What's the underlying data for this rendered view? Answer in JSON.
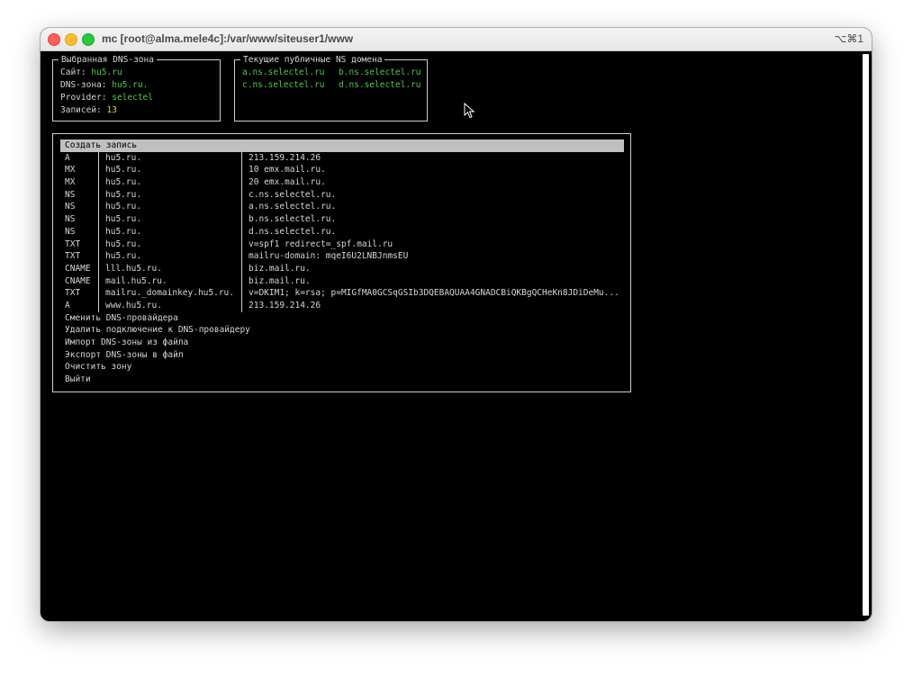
{
  "window": {
    "title": "mc [root@alma.mele4c]:/var/www/siteuser1/www",
    "shortcut": "⌥⌘1"
  },
  "zone_panel": {
    "legend": "Выбранная DNS-зона",
    "site_label": "Сайт:",
    "site_value": "hu5.ru",
    "zone_label": "DNS-зона:",
    "zone_value": "hu5.ru.",
    "provider_label": "Provider:",
    "provider_value": "selectel",
    "records_label": "Записей:",
    "records_value": "13"
  },
  "ns_panel": {
    "legend": "Текущие публичные NS домена",
    "ns": [
      "a.ns.selectel.ru",
      "b.ns.selectel.ru",
      "c.ns.selectel.ru",
      "d.ns.selectel.ru"
    ]
  },
  "menu": {
    "create": "Создать запись",
    "records": [
      {
        "type": "A",
        "name": "hu5.ru.",
        "value": "213.159.214.26"
      },
      {
        "type": "MX",
        "name": "hu5.ru.",
        "value": "10 emx.mail.ru."
      },
      {
        "type": "MX",
        "name": "hu5.ru.",
        "value": "20 emx.mail.ru."
      },
      {
        "type": "NS",
        "name": "hu5.ru.",
        "value": "c.ns.selectel.ru."
      },
      {
        "type": "NS",
        "name": "hu5.ru.",
        "value": "a.ns.selectel.ru."
      },
      {
        "type": "NS",
        "name": "hu5.ru.",
        "value": "b.ns.selectel.ru."
      },
      {
        "type": "NS",
        "name": "hu5.ru.",
        "value": "d.ns.selectel.ru."
      },
      {
        "type": "TXT",
        "name": "hu5.ru.",
        "value": "v=spf1 redirect=_spf.mail.ru"
      },
      {
        "type": "TXT",
        "name": "hu5.ru.",
        "value": "mailru-domain: mqeI6U2LNBJnmsEU"
      },
      {
        "type": "CNAME",
        "name": "lll.hu5.ru.",
        "value": "biz.mail.ru."
      },
      {
        "type": "CNAME",
        "name": "mail.hu5.ru.",
        "value": "biz.mail.ru."
      },
      {
        "type": "TXT",
        "name": "mailru._domainkey.hu5.ru.",
        "value": "v=DKIM1; k=rsa; p=MIGfMA0GCSqGSIb3DQEBAQUAA4GNADCBiQKBgQCHeKn8JDiDeMu..."
      },
      {
        "type": "A",
        "name": "www.hu5.ru.",
        "value": "213.159.214.26"
      }
    ],
    "actions": [
      "Сменить DNS-провайдера",
      "Удалить подключение к DNS-провайдеру",
      "Импорт DNS-зоны из файла",
      "Экспорт DNS-зоны в файл",
      "Очистить зону",
      "Выйти"
    ]
  },
  "colors": {
    "highlight": "#4ec94e",
    "count": "#e6c84a",
    "selection": "#c0c0c0"
  }
}
